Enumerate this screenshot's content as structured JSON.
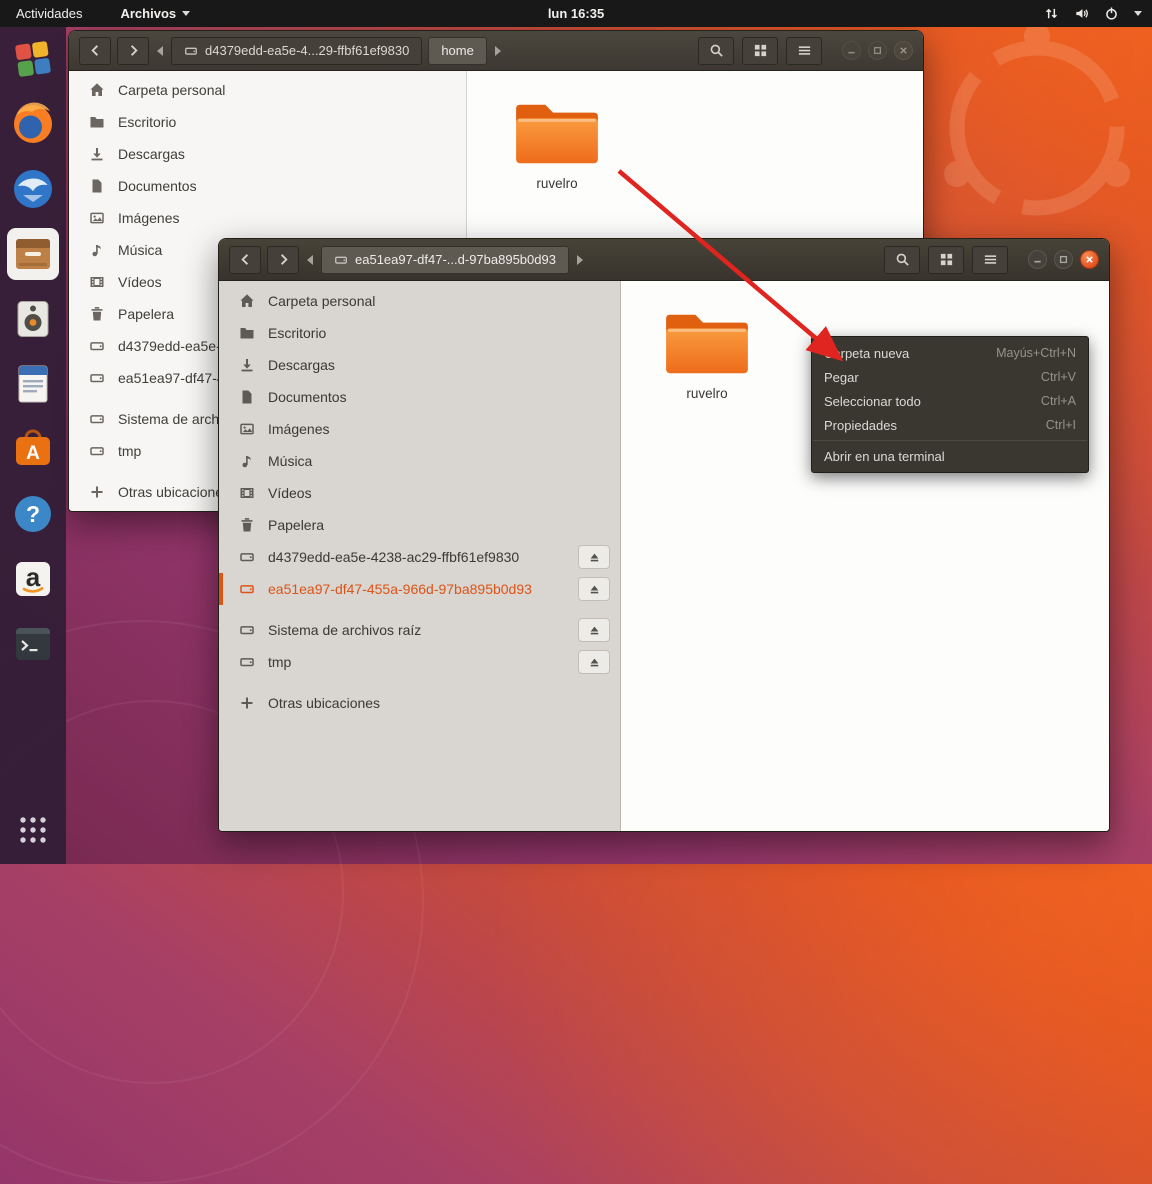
{
  "colors": {
    "accent": "#e95420",
    "selection-orange": "#dd5417",
    "arrow-red": "#e0241f",
    "folder-orange": "#f0731f",
    "topbar-bg": "#181818",
    "menu-bg": "#3a3731"
  },
  "top_bar": {
    "activities": "Actividades",
    "app_menu": "Archivos",
    "clock": "lun 16:35"
  },
  "dock": {
    "items": [
      {
        "name": "aplicación multicolor"
      },
      {
        "name": "Firefox"
      },
      {
        "name": "Thunderbird"
      },
      {
        "name": "Archivos",
        "active": true
      },
      {
        "name": "Rhythmbox"
      },
      {
        "name": "LibreOffice Writer"
      },
      {
        "name": "Software de Ubuntu",
        "glyph": "A"
      },
      {
        "name": "Ayuda",
        "glyph": "?"
      },
      {
        "name": "Amazon",
        "glyph": "a"
      },
      {
        "name": "Terminal"
      },
      {
        "name": "Mostrar aplicaciones"
      }
    ]
  },
  "window_back": {
    "path_segments": [
      {
        "label": "d4379edd-ea5e-4...29-ffbf61ef9830"
      },
      {
        "label": "home",
        "current": true
      }
    ],
    "sidebar_items": [
      "Carpeta personal",
      "Escritorio",
      "Descargas",
      "Documentos",
      "Imágenes",
      "Música",
      "Vídeos",
      "Papelera",
      "d4379edd-ea5e-4238-ac29-ffbf61ef9830",
      "ea51ea97-df47-455a-966d-97ba895b0d93",
      "Sistema de archivos raíz",
      "tmp",
      "Otras ubicaciones"
    ],
    "files": [
      {
        "name": "ruvelro"
      }
    ]
  },
  "window_front": {
    "path_segments": [
      {
        "label": "ea51ea97-df47-...d-97ba895b0d93",
        "current": true
      }
    ],
    "sidebar_items": [
      {
        "label": "Carpeta personal"
      },
      {
        "label": "Escritorio"
      },
      {
        "label": "Descargas"
      },
      {
        "label": "Documentos"
      },
      {
        "label": "Imágenes"
      },
      {
        "label": "Música"
      },
      {
        "label": "Vídeos"
      },
      {
        "label": "Papelera"
      },
      {
        "label": "d4379edd-ea5e-4238-ac29-ffbf61ef9830",
        "eject": true
      },
      {
        "label": "ea51ea97-df47-455a-966d-97ba895b0d93",
        "eject": true,
        "selected": true
      },
      {
        "label": "Sistema de archivos raíz",
        "eject": true
      },
      {
        "label": "tmp",
        "eject": true
      },
      {
        "label": "Otras ubicaciones"
      }
    ],
    "files": [
      {
        "name": "ruvelro"
      }
    ],
    "context_menu": {
      "items": [
        {
          "label": "Carpeta nueva",
          "shortcut": "Mayús+Ctrl+N"
        },
        {
          "label": "Pegar",
          "shortcut": "Ctrl+V"
        },
        {
          "label": "Seleccionar todo",
          "shortcut": "Ctrl+A"
        },
        {
          "label": "Propiedades",
          "shortcut": "Ctrl+I"
        },
        {
          "label": "Abrir en una terminal",
          "shortcut": ""
        }
      ]
    }
  },
  "annotation": {
    "arrow_points_to": "Pegar"
  }
}
